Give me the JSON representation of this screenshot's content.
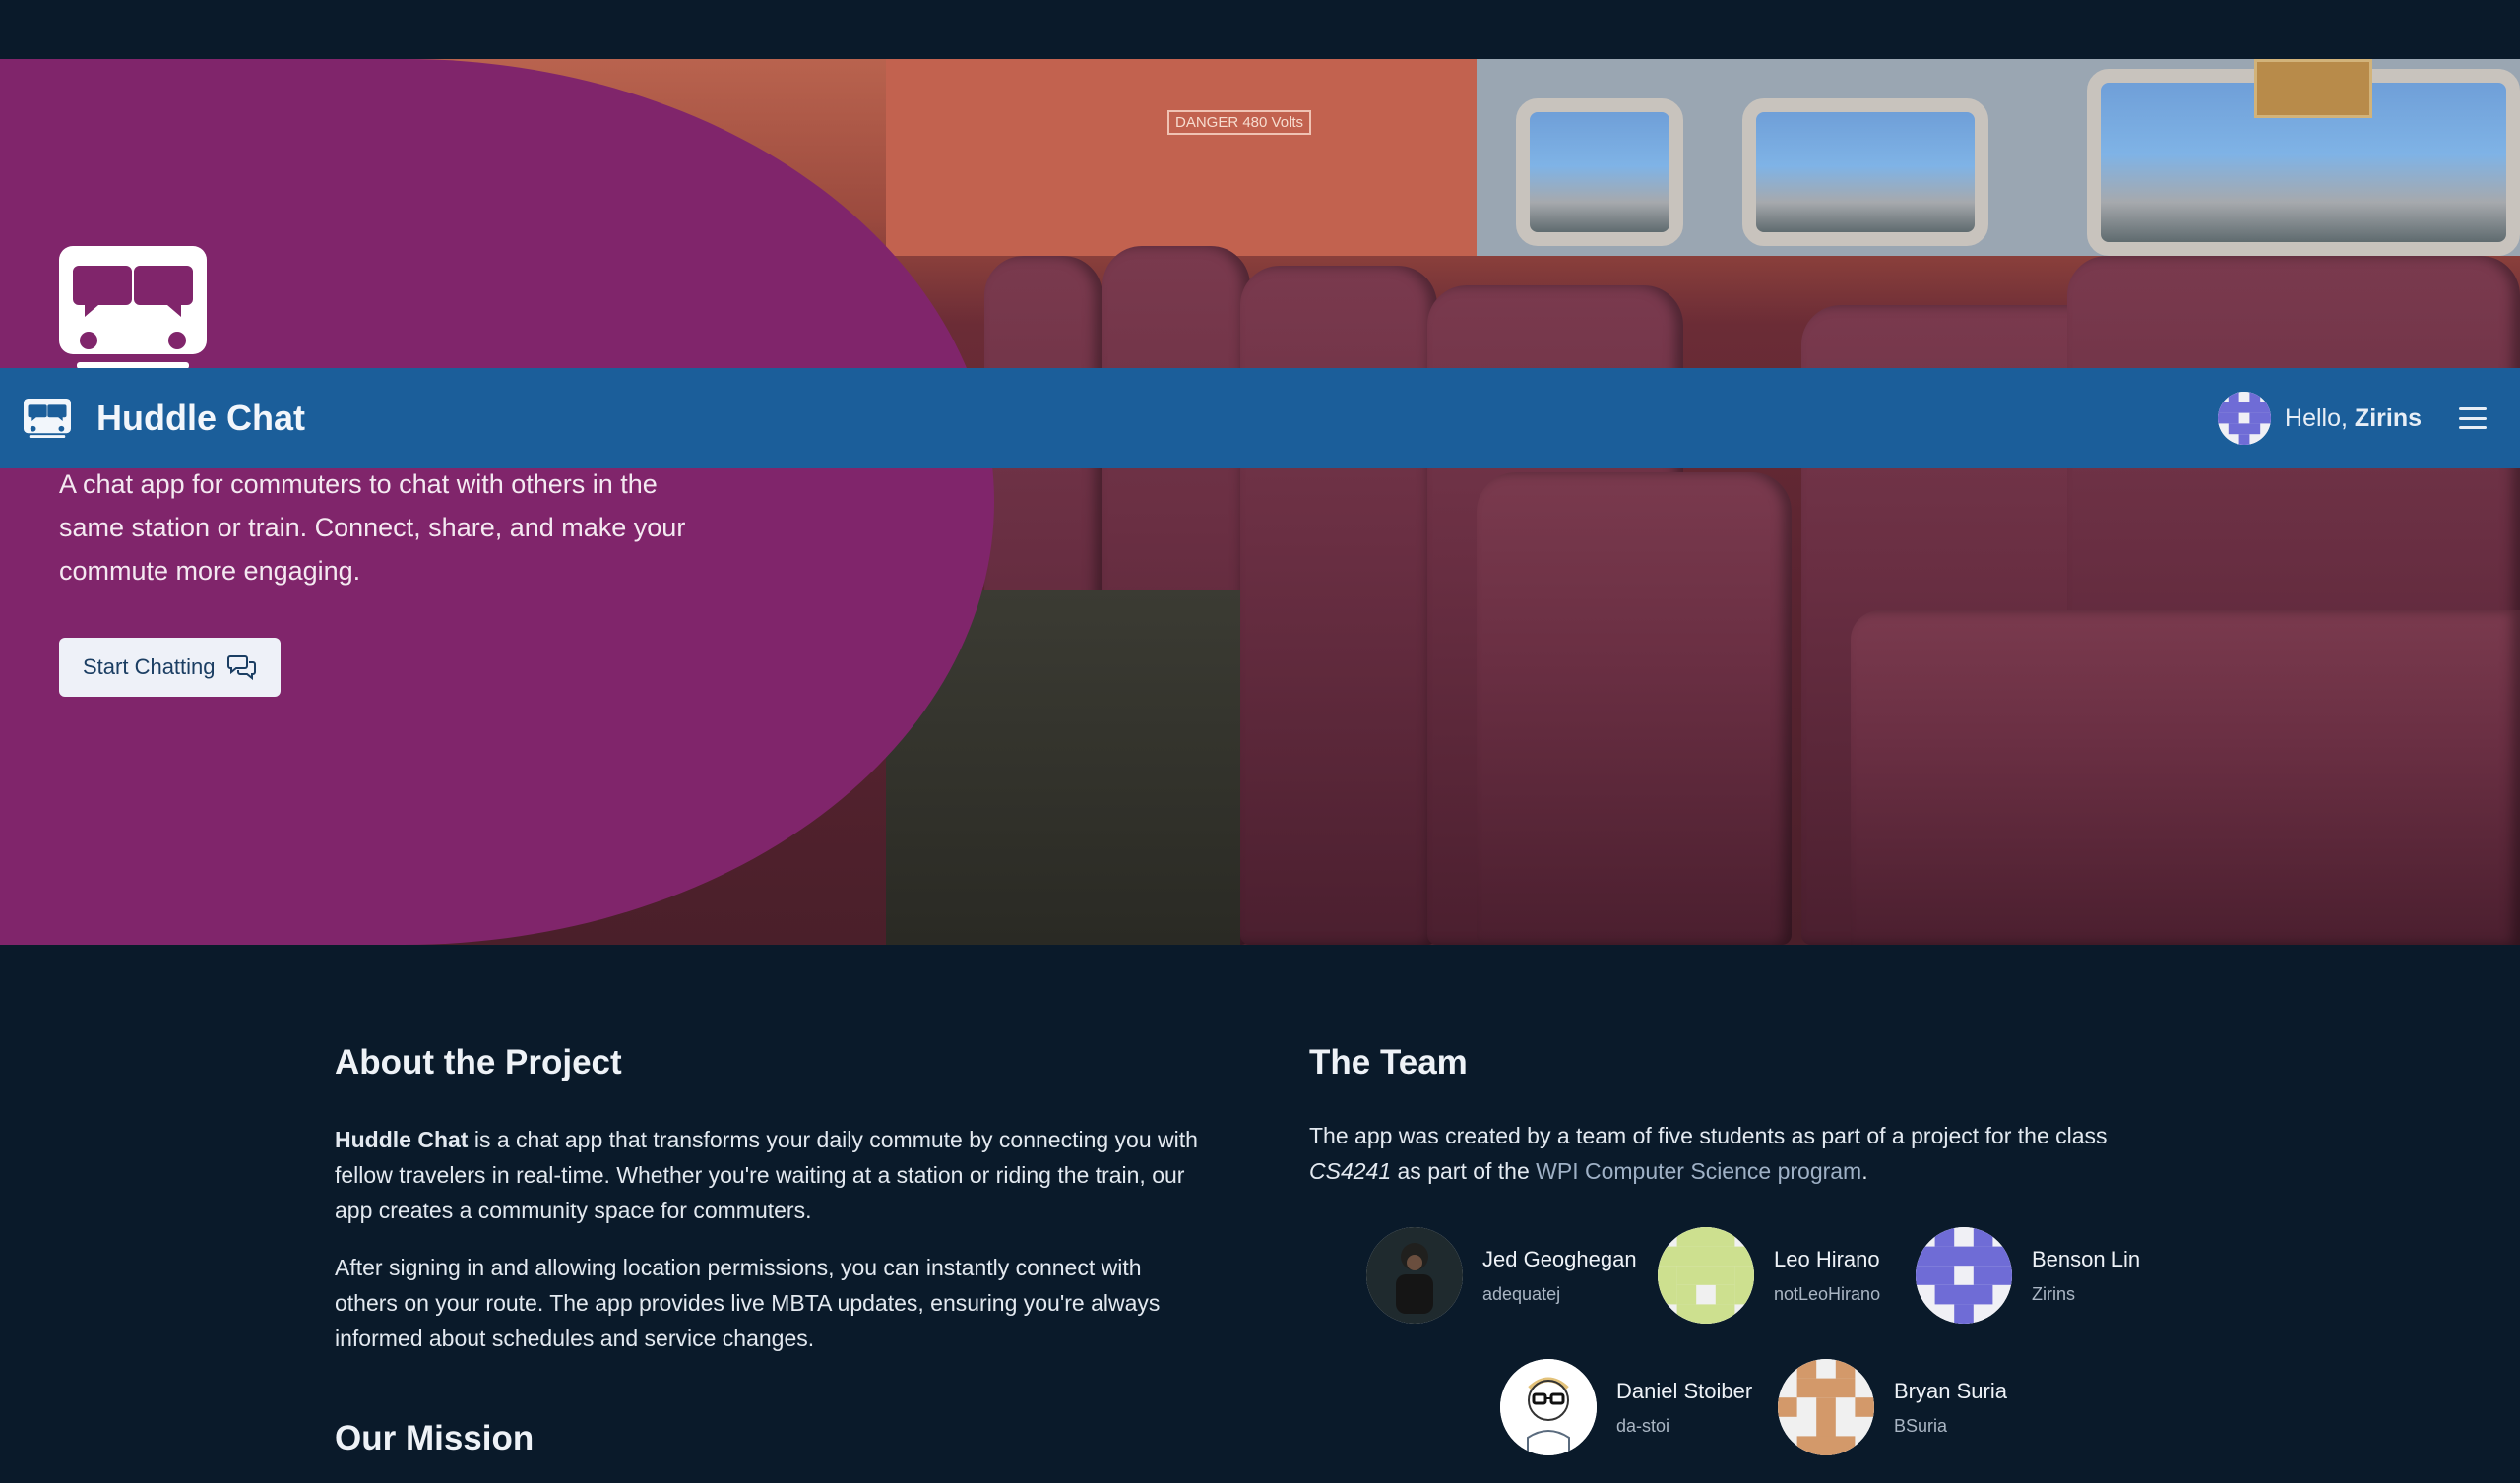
{
  "brand": {
    "name": "Huddle Chat",
    "icon": "tram-chat-icon"
  },
  "user": {
    "greeting": "Hello, ",
    "name": "Zirins",
    "avatar": "identicon-avatar"
  },
  "hero": {
    "description": "A chat app for commuters to chat with others in the same station or train. Connect, share, and make your commute more engaging.",
    "cta_label": "Start Chatting",
    "cta_icon": "chat-bubbles-icon",
    "sign_text": "DANGER 480 Volts"
  },
  "about": {
    "title": "About the Project",
    "p1_strong": "Huddle Chat",
    "p1_rest": " is a chat app that transforms your daily commute by connecting you with fellow travelers in real-time. Whether you're waiting at a station or riding the train, our app creates a community space for commuters.",
    "p2": "After signing in and allowing location permissions, you can instantly connect with others on your route. The app provides live MBTA updates, ensuring you're always informed about schedules and service changes.",
    "mission_title": "Our Mission"
  },
  "team": {
    "title": "The Team",
    "intro_a": "The app was created by a team of five students as part of a project for the class ",
    "course": "CS4241",
    "intro_b": " as part of the ",
    "program_link": "WPI Computer Science program",
    "intro_c": ".",
    "members": [
      {
        "name": "Jed Geoghegan",
        "username": "adequatej"
      },
      {
        "name": "Leo Hirano",
        "username": "notLeoHirano"
      },
      {
        "name": "Benson Lin",
        "username": "Zirins"
      },
      {
        "name": "Daniel Stoiber",
        "username": "da-stoi"
      },
      {
        "name": "Bryan Suria",
        "username": "BSuria"
      }
    ]
  },
  "colors": {
    "navbar": "#1b5e9a",
    "hero_blob": "#80256b",
    "page_bg": "#0a1a2a"
  }
}
